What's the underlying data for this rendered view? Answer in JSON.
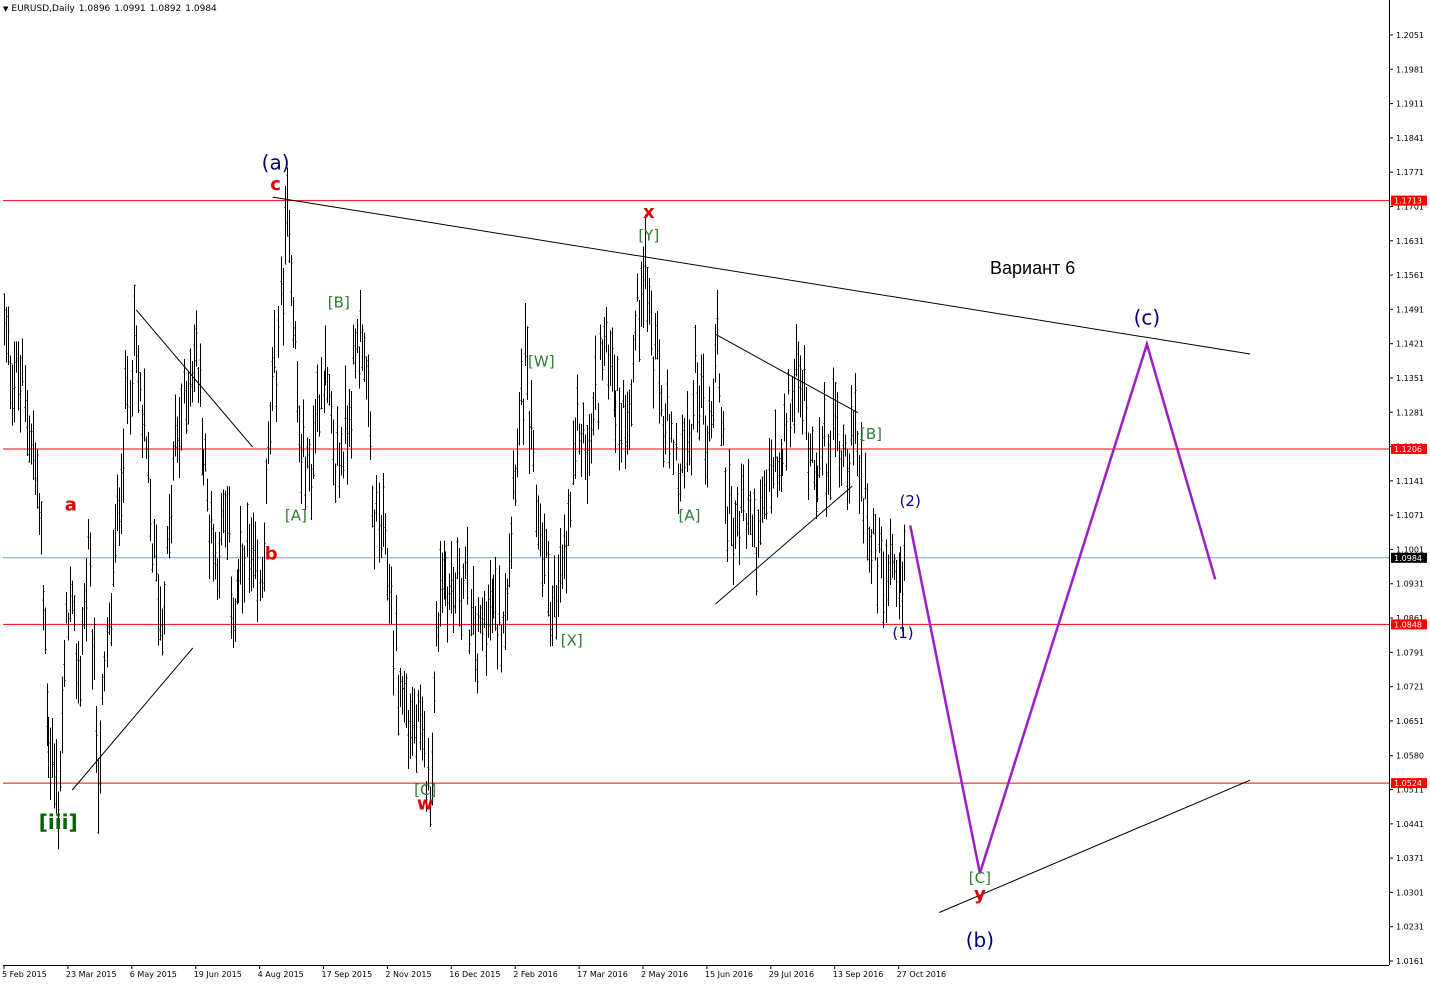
{
  "header": {
    "arrow": "▼",
    "symbol": "EURUSD,Daily",
    "open": "1.0896",
    "high": "1.0991",
    "low": "1.0892",
    "close": "1.0984"
  },
  "title": "Вариант 6",
  "colors": {
    "background": "#ffffff",
    "candles": "#000000",
    "level": "#ff0000",
    "current": "#7f9fc8",
    "projection": "#9b1fc9",
    "red": "#e00000",
    "green": "#2e7d32",
    "navy": "#000080",
    "dark_green": "#006400"
  },
  "chart_data": {
    "type": "line",
    "yrange": [
      1.0161,
      1.2101
    ],
    "y_ticks": [
      "1.2051",
      "1.1981",
      "1.1911",
      "1.1841",
      "1.1771",
      "1.1701",
      "1.1631",
      "1.1561",
      "1.1491",
      "1.1421",
      "1.1351",
      "1.1281",
      "1.1211",
      "1.1141",
      "1.1071",
      "1.1001",
      "1.0931",
      "1.0861",
      "1.0791",
      "1.0721",
      "1.0651",
      "1.0580",
      "1.0511",
      "1.0441",
      "1.0371",
      "1.0301",
      "1.0231",
      "1.0161"
    ],
    "x_ticks": [
      "5 Feb 2015",
      "23 Mar 2015",
      "6 May 2015",
      "19 Jun 2015",
      "4 Aug 2015",
      "17 Sep 2015",
      "2 Nov 2015",
      "16 Dec 2015",
      "2 Feb 2016",
      "17 Mar 2016",
      "2 May 2016",
      "15 Jun 2016",
      "29 Jul 2016",
      "13 Sep 2016",
      "27 Oct 2016"
    ],
    "levels": [
      {
        "price": 1.1713,
        "label": "1.1713"
      },
      {
        "price": 1.1206,
        "label": "1.1206"
      },
      {
        "price": 1.0848,
        "label": "1.0848"
      },
      {
        "price": 1.0524,
        "label": "1.0524"
      }
    ],
    "current_price": {
      "price": 1.0984,
      "label": "1.0984"
    },
    "price_path": [
      [
        "5 Feb 2015",
        1.146
      ],
      [
        "12 Feb 2015",
        1.136
      ],
      [
        "23 Feb 2015",
        1.128
      ],
      [
        "2 Mar 2015",
        1.108
      ],
      [
        "9 Mar 2015",
        1.062
      ],
      [
        "16 Mar 2015",
        1.048
      ],
      [
        "23 Mar 2015",
        1.09
      ],
      [
        "30 Mar 2015",
        1.074
      ],
      [
        "6 Apr 2015",
        1.097
      ],
      [
        "13 Apr 2015",
        1.055
      ],
      [
        "20 Apr 2015",
        1.082
      ],
      [
        "27 Apr 2015",
        1.112
      ],
      [
        "6 May 2015",
        1.143
      ],
      [
        "13 May 2015",
        1.128
      ],
      [
        "20 May 2015",
        1.102
      ],
      [
        "27 May 2015",
        1.086
      ],
      [
        "5 Jun 2015",
        1.12
      ],
      [
        "12 Jun 2015",
        1.132
      ],
      [
        "19 Jun 2015",
        1.141
      ],
      [
        "26 Jun 2015",
        1.114
      ],
      [
        "3 Jul 2015",
        1.099
      ],
      [
        "10 Jul 2015",
        1.107
      ],
      [
        "17 Jul 2015",
        1.086
      ],
      [
        "24 Jul 2015",
        1.099
      ],
      [
        "4 Aug 2015",
        1.09
      ],
      [
        "10 Aug 2015",
        1.118
      ],
      [
        "17 Aug 2015",
        1.145
      ],
      [
        "24 Aug 2015",
        1.171
      ],
      [
        "31 Aug 2015",
        1.122
      ],
      [
        "7 Sep 2015",
        1.114
      ],
      [
        "17 Sep 2015",
        1.14
      ],
      [
        "24 Sep 2015",
        1.117
      ],
      [
        "1 Oct 2015",
        1.121
      ],
      [
        "8 Oct 2015",
        1.136
      ],
      [
        "15 Oct 2015",
        1.148
      ],
      [
        "22 Oct 2015",
        1.109
      ],
      [
        "2 Nov 2015",
        1.097
      ],
      [
        "9 Nov 2015",
        1.074
      ],
      [
        "16 Nov 2015",
        1.066
      ],
      [
        "23 Nov 2015",
        1.061
      ],
      [
        "1 Dec 2015",
        1.053
      ],
      [
        "8 Dec 2015",
        1.096
      ],
      [
        "16 Dec 2015",
        1.091
      ],
      [
        "23 Dec 2015",
        1.096
      ],
      [
        "4 Jan 2016",
        1.079
      ],
      [
        "11 Jan 2016",
        1.09
      ],
      [
        "18 Jan 2016",
        1.085
      ],
      [
        "25 Jan 2016",
        1.091
      ],
      [
        "2 Feb 2016",
        1.121
      ],
      [
        "9 Feb 2016",
        1.137
      ],
      [
        "16 Feb 2016",
        1.11
      ],
      [
        "23 Feb 2016",
        1.097
      ],
      [
        "1 Mar 2016",
        1.086
      ],
      [
        "8 Mar 2016",
        1.1
      ],
      [
        "17 Mar 2016",
        1.127
      ],
      [
        "24 Mar 2016",
        1.118
      ],
      [
        "1 Apr 2016",
        1.139
      ],
      [
        "8 Apr 2016",
        1.142
      ],
      [
        "15 Apr 2016",
        1.127
      ],
      [
        "22 Apr 2016",
        1.13
      ],
      [
        "2 May 2016",
        1.161
      ],
      [
        "9 May 2016",
        1.14
      ],
      [
        "16 May 2016",
        1.128
      ],
      [
        "23 May 2016",
        1.115
      ],
      [
        "1 Jun 2016",
        1.118
      ],
      [
        "8 Jun 2016",
        1.138
      ],
      [
        "15 Jun 2016",
        1.122
      ],
      [
        "22 Jun 2016",
        1.142
      ],
      [
        "29 Jun 2016",
        1.109
      ],
      [
        "6 Jul 2016",
        1.105
      ],
      [
        "13 Jul 2016",
        1.109
      ],
      [
        "20 Jul 2016",
        1.1
      ],
      [
        "29 Jul 2016",
        1.117
      ],
      [
        "5 Aug 2016",
        1.113
      ],
      [
        "12 Aug 2016",
        1.131
      ],
      [
        "19 Aug 2016",
        1.134
      ],
      [
        "26 Aug 2016",
        1.122
      ],
      [
        "2 Sep 2016",
        1.118
      ],
      [
        "13 Sep 2016",
        1.124
      ],
      [
        "20 Sep 2016",
        1.121
      ],
      [
        "27 Sep 2016",
        1.122
      ],
      [
        "4 Oct 2016",
        1.112
      ],
      [
        "11 Oct 2016",
        1.098
      ],
      [
        "18 Oct 2016",
        1.094
      ],
      [
        "27 Oct 2016",
        1.089
      ],
      [
        "1 Nov 2016",
        1.098
      ]
    ],
    "projection": [
      [
        "4 Nov 2016",
        1.105
      ],
      [
        "22 Dec 2016",
        1.034
      ],
      [
        "16 Apr 2017",
        1.142
      ],
      [
        "2 Jun 2017",
        1.094
      ]
    ],
    "trendlines": [
      {
        "points": [
          [
            "13 Aug 2015",
            1.172
          ],
          [
            "26 Jun 2017",
            1.14
          ]
        ]
      },
      {
        "points": [
          [
            "24 Nov 2016",
            1.026
          ],
          [
            "26 Jun 2017",
            1.053
          ]
        ]
      },
      {
        "points": [
          [
            "26 Mar 2015",
            1.051
          ],
          [
            "17 Jun 2015",
            1.08
          ]
        ]
      },
      {
        "points": [
          [
            "9 May 2015",
            1.149
          ],
          [
            "30 Jul 2015",
            1.121
          ]
        ]
      },
      {
        "points": [
          [
            "21 Jun 2016",
            1.144
          ],
          [
            "29 Sep 2016",
            1.128
          ]
        ]
      },
      {
        "points": [
          [
            "21 Jun 2016",
            1.089
          ],
          [
            "25 Sep 2016",
            1.113
          ]
        ]
      }
    ],
    "wave_labels": [
      {
        "text": "(a)",
        "date": "15 Aug 2015",
        "price": 1.1776,
        "color": "navy",
        "size": 20
      },
      {
        "text": "c",
        "date": "15 Aug 2015",
        "price": 1.1735,
        "color": "red",
        "size": 18
      },
      {
        "text": "x",
        "date": "6 May 2016",
        "price": 1.1677,
        "color": "red",
        "size": 18
      },
      {
        "text": "[Y]",
        "date": "6 May 2016",
        "price": 1.1632,
        "color": "green",
        "size": 15
      },
      {
        "text": "[B]",
        "date": "28 Sep 2015",
        "price": 1.1495,
        "color": "green",
        "size": 15
      },
      {
        "text": "[W]",
        "date": "20 Feb 2016",
        "price": 1.1374,
        "color": "green",
        "size": 15
      },
      {
        "text": "[B]",
        "date": "8 Oct 2016",
        "price": 1.1226,
        "color": "green",
        "size": 15
      },
      {
        "text": "a",
        "date": "25 Mar 2015",
        "price": 1.108,
        "color": "red",
        "size": 18
      },
      {
        "text": "b",
        "date": "12 Aug 2015",
        "price": 1.098,
        "color": "red",
        "size": 18
      },
      {
        "text": "[A]",
        "date": "29 Aug 2015",
        "price": 1.106,
        "color": "green",
        "size": 15
      },
      {
        "text": "[A]",
        "date": "3 Jun 2016",
        "price": 1.106,
        "color": "green",
        "size": 15
      },
      {
        "text": "(2)",
        "date": "4 Nov 2016",
        "price": 1.109,
        "color": "navy",
        "size": 15
      },
      {
        "text": "(1)",
        "date": "30 Oct 2016",
        "price": 1.082,
        "color": "navy",
        "size": 15
      },
      {
        "text": "[X]",
        "date": "12 Mar 2016",
        "price": 1.0805,
        "color": "green",
        "size": 15
      },
      {
        "text": "[C]",
        "date": "28 Nov 2015",
        "price": 1.05,
        "color": "green",
        "size": 15
      },
      {
        "text": "w",
        "date": "28 Nov 2015",
        "price": 1.047,
        "color": "red",
        "size": 18
      },
      {
        "text": "[iii]",
        "date": "16 Mar 2015",
        "price": 1.043,
        "color": "dark_green",
        "size": 20
      },
      {
        "text": "[C]",
        "date": "22 Dec 2016",
        "price": 1.032,
        "color": "green",
        "size": 15
      },
      {
        "text": "y",
        "date": "22 Dec 2016",
        "price": 1.0285,
        "color": "red",
        "size": 18
      },
      {
        "text": "(b)",
        "date": "22 Dec 2016",
        "price": 1.019,
        "color": "navy",
        "size": 20
      },
      {
        "text": "(c)",
        "date": "16 Apr 2017",
        "price": 1.146,
        "color": "navy",
        "size": 20
      }
    ]
  }
}
